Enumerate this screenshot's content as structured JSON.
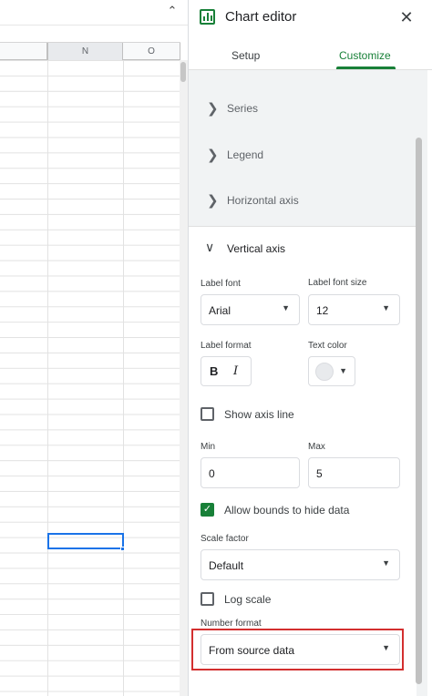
{
  "sheet": {
    "collapse_icon": "⌃",
    "columns": [
      "N",
      "O"
    ]
  },
  "panel": {
    "title": "Chart editor",
    "close_icon": "✕",
    "tabs": [
      {
        "label": "Setup",
        "active": false
      },
      {
        "label": "Customize",
        "active": true
      }
    ],
    "sections": [
      {
        "label": "Series",
        "expanded": false
      },
      {
        "label": "Legend",
        "expanded": false
      },
      {
        "label": "Horizontal axis",
        "expanded": false
      },
      {
        "label": "Vertical axis",
        "expanded": true
      }
    ],
    "vertical_axis": {
      "label_font": {
        "label": "Label font",
        "value": "Arial"
      },
      "label_font_size": {
        "label": "Label font size",
        "value": "12"
      },
      "label_format": {
        "label": "Label format",
        "bold": "B",
        "italic": "I"
      },
      "text_color": {
        "label": "Text color",
        "swatch": "#e8eaed"
      },
      "show_axis_line": {
        "label": "Show axis line",
        "checked": false
      },
      "min": {
        "label": "Min",
        "value": "0"
      },
      "max": {
        "label": "Max",
        "value": "5"
      },
      "allow_bounds": {
        "label": "Allow bounds to hide data",
        "checked": true
      },
      "scale_factor": {
        "label": "Scale factor",
        "value": "Default"
      },
      "log_scale": {
        "label": "Log scale",
        "checked": false
      },
      "number_format": {
        "label": "Number format",
        "value": "From source data"
      }
    }
  },
  "icons": {
    "chevron_right": "❯",
    "chevron_down": "∨",
    "caret_down": "▼",
    "check": "✓"
  },
  "colors": {
    "accent": "#188038",
    "selection": "#1a73e8",
    "highlight": "#d32f2f"
  }
}
